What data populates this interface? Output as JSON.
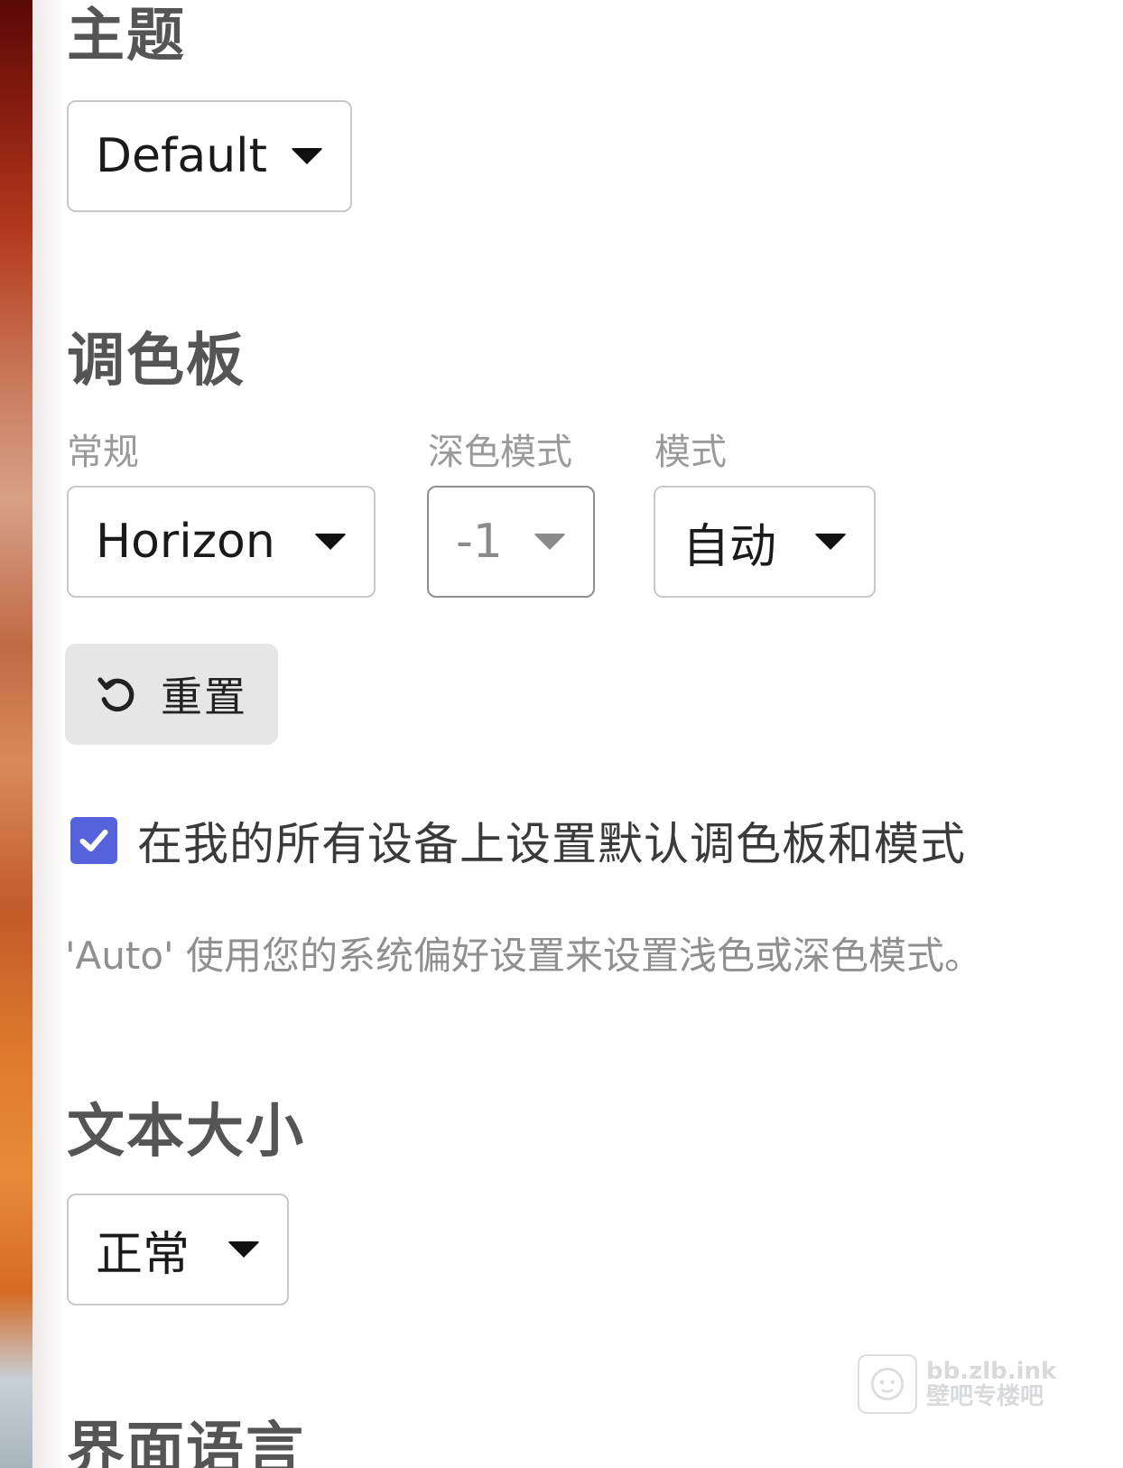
{
  "theme": {
    "title": "主题",
    "select_value": "Default"
  },
  "palette": {
    "title": "调色板",
    "regular_label": "常规",
    "regular_value": "Horizon",
    "dark_label": "深色模式",
    "dark_value": "-1",
    "mode_label": "模式",
    "mode_value": "自动",
    "reset_label": "重置",
    "checkbox_checked": true,
    "checkbox_label": "在我的所有设备上设置默认调色板和模式",
    "help_text": "'Auto' 使用您的系统偏好设置来设置浅色或深色模式。"
  },
  "text_size": {
    "title": "文本大小",
    "select_value": "正常"
  },
  "ui_language": {
    "title": "界面语言"
  },
  "watermark": {
    "line1": "bb.zlb.ink",
    "line2": "壁吧专楼吧"
  },
  "colors": {
    "checkbox_accent": "#5562db",
    "heading": "#555555",
    "label": "#9a9a9a"
  }
}
